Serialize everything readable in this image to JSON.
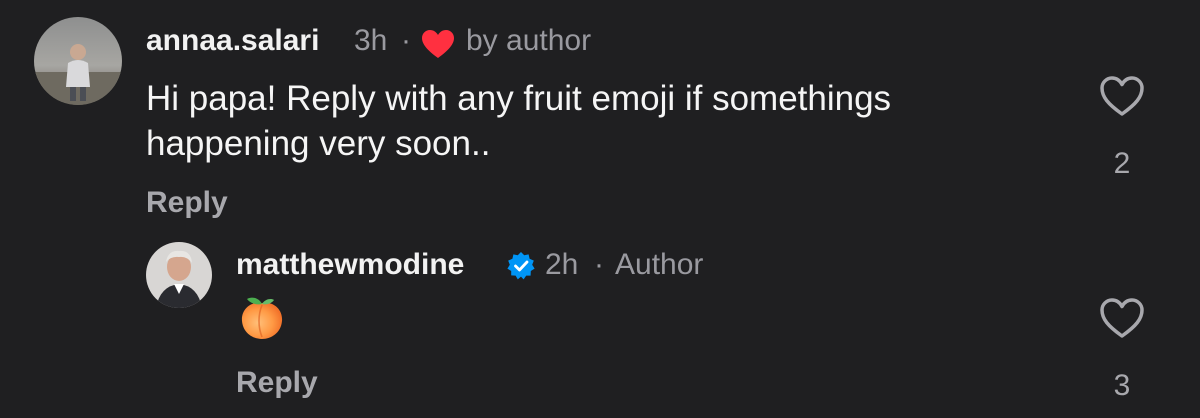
{
  "comments": [
    {
      "username": "annaa.salari",
      "time": "3h",
      "separator": "·",
      "liked_by_author_icon": "heart-filled-icon",
      "liked_by_label": "by author",
      "text": "Hi papa! Reply with any fruit emoji if somethings happening very soon..",
      "reply_label": "Reply",
      "like_count": "2"
    },
    {
      "username": "matthewmodine",
      "verified_icon": "verified-badge-icon",
      "time": "2h",
      "separator": "·",
      "role_label": "Author",
      "text_emoji_icon": "peach-emoji-icon",
      "reply_label": "Reply",
      "like_count": "3"
    }
  ],
  "colors": {
    "background": "#1f1f21",
    "heart_red": "#ff3040",
    "verified_blue": "#0095f6",
    "muted_text": "#9a9aa0"
  }
}
